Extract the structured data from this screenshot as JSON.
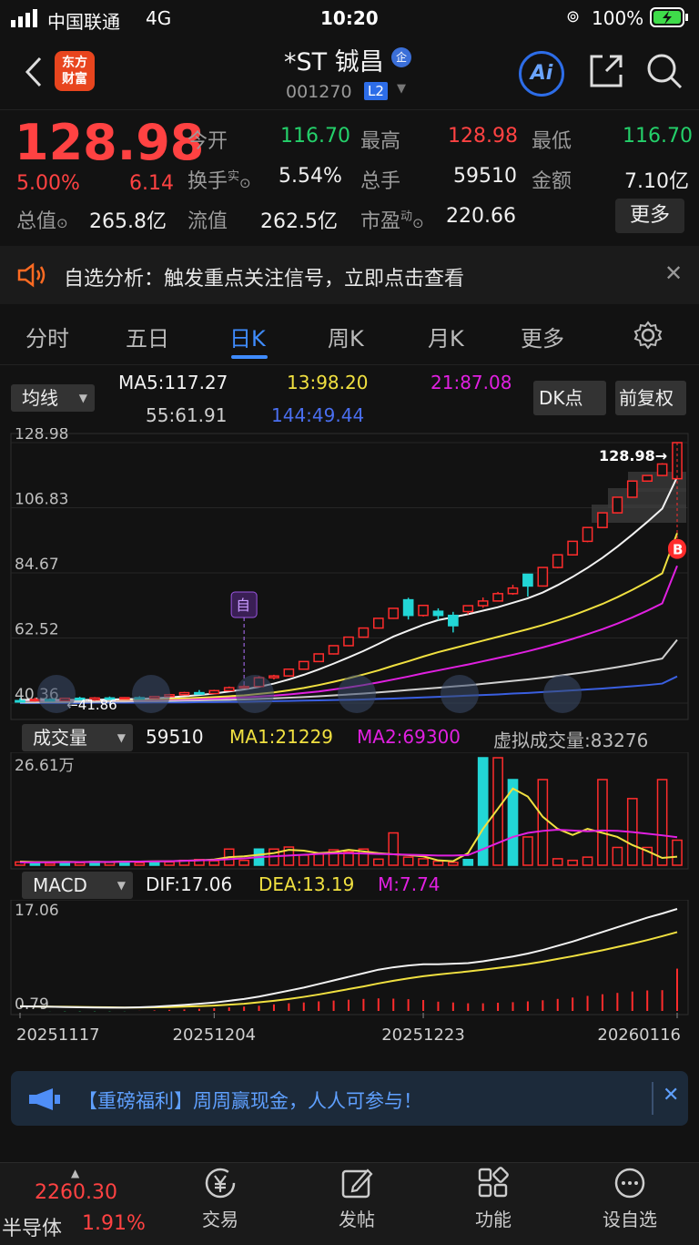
{
  "status": {
    "carrier": "中国联通",
    "network": "4G",
    "time": "10:20",
    "battery": "100%"
  },
  "header": {
    "logo_line1": "东方",
    "logo_line2": "财富",
    "title": "*ST 铖昌",
    "code": "001270",
    "level": "L2",
    "ai_label": "Ai"
  },
  "quote": {
    "price": "128.98",
    "change_pct": "5.00%",
    "change_amt": "6.14",
    "open_label": "今开",
    "open": "116.70",
    "high_label": "最高",
    "high": "128.98",
    "low_label": "最低",
    "low": "116.70",
    "turnover_label": "换手",
    "turnover_sup": "实",
    "turnover": "5.54%",
    "volume_label": "总手",
    "volume": "59510",
    "amount_label": "金额",
    "amount": "7.10亿",
    "mktcap_label": "总值",
    "mktcap": "265.8亿",
    "float_label": "流值",
    "float_cap": "262.5亿",
    "pe_label": "市盈",
    "pe_sup": "动",
    "pe": "220.66",
    "more_label": "更多"
  },
  "notice": {
    "text": "自选分析：触发重点关注信号，立即点击查看"
  },
  "tabs": [
    {
      "label": "分时"
    },
    {
      "label": "五日"
    },
    {
      "label": "日K"
    },
    {
      "label": "周K"
    },
    {
      "label": "月K"
    },
    {
      "label": "更多"
    }
  ],
  "active_tab": "日K",
  "kline_header": {
    "indicator": "均线",
    "ma5": "MA5:117.27",
    "ma13": "13:98.20",
    "ma21": "21:87.08",
    "ma55": "55:61.91",
    "ma144": "144:49.44",
    "dk_label": "DK点",
    "adjust_label": "前复权",
    "badge_self": "自",
    "badge_buy": "B",
    "latest_tag": "128.98"
  },
  "volume_header": {
    "indicator": "成交量",
    "vol": "59510",
    "ma1": "MA1:21229",
    "ma2": "MA2:69300",
    "virtual": "虚拟成交量:83276"
  },
  "macd_header": {
    "indicator": "MACD",
    "dif": "DIF:17.06",
    "dea": "DEA:13.19",
    "m": "M:7.74"
  },
  "colors": {
    "up": "#ff2c2c",
    "down": "#22d6d6",
    "ma5": "#f2f2f2",
    "ma13": "#f0e040",
    "ma21": "#e020e0",
    "ma55": "#cfcfcf",
    "ma144": "#3a5fe0"
  },
  "chart_data": [
    {
      "type": "candlestick",
      "title": "日K",
      "y_ticks": [
        "128.98",
        "106.83",
        "84.67",
        "62.52",
        "40.36"
      ],
      "ylim": [
        40.36,
        128.98
      ],
      "min_label": "41.86",
      "candles": [
        {
          "o": 41.2,
          "h": 42.0,
          "l": 40.6,
          "c": 41.0
        },
        {
          "o": 41.4,
          "h": 42.2,
          "l": 40.8,
          "c": 41.6
        },
        {
          "o": 41.6,
          "h": 42.0,
          "l": 40.9,
          "c": 41.1
        },
        {
          "o": 41.2,
          "h": 42.2,
          "l": 41.0,
          "c": 42.0
        },
        {
          "o": 42.0,
          "h": 42.5,
          "l": 41.3,
          "c": 41.5
        },
        {
          "o": 41.5,
          "h": 42.4,
          "l": 41.2,
          "c": 42.1
        },
        {
          "o": 42.1,
          "h": 42.6,
          "l": 41.6,
          "c": 41.9
        },
        {
          "o": 41.9,
          "h": 42.4,
          "l": 41.7,
          "c": 42.2
        },
        {
          "o": 42.2,
          "h": 42.7,
          "l": 41.9,
          "c": 42.0
        },
        {
          "o": 42.0,
          "h": 42.8,
          "l": 41.86,
          "c": 42.6
        },
        {
          "o": 42.6,
          "h": 43.5,
          "l": 42.4,
          "c": 43.2
        },
        {
          "o": 43.2,
          "h": 44.2,
          "l": 43.0,
          "c": 43.9
        },
        {
          "o": 43.9,
          "h": 44.8,
          "l": 43.4,
          "c": 43.6
        },
        {
          "o": 43.6,
          "h": 44.9,
          "l": 43.5,
          "c": 44.6
        },
        {
          "o": 44.6,
          "h": 46.0,
          "l": 44.4,
          "c": 45.6
        },
        {
          "o": 45.6,
          "h": 46.6,
          "l": 45.3,
          "c": 46.0
        },
        {
          "o": 46.0,
          "h": 49.5,
          "l": 45.8,
          "c": 49.0
        },
        {
          "o": 49.0,
          "h": 50.0,
          "l": 48.4,
          "c": 49.6
        },
        {
          "o": 49.6,
          "h": 52.0,
          "l": 49.4,
          "c": 51.9
        },
        {
          "o": 51.9,
          "h": 54.6,
          "l": 51.7,
          "c": 54.5
        },
        {
          "o": 54.5,
          "h": 57.2,
          "l": 54.3,
          "c": 57.1
        },
        {
          "o": 57.1,
          "h": 60.0,
          "l": 56.9,
          "c": 59.9
        },
        {
          "o": 59.9,
          "h": 62.9,
          "l": 59.7,
          "c": 62.8
        },
        {
          "o": 62.8,
          "h": 65.9,
          "l": 62.6,
          "c": 65.9
        },
        {
          "o": 65.9,
          "h": 69.2,
          "l": 65.7,
          "c": 69.2
        },
        {
          "o": 69.2,
          "h": 72.6,
          "l": 69.0,
          "c": 72.6
        },
        {
          "o": 75.5,
          "h": 76.2,
          "l": 68.8,
          "c": 70.2
        },
        {
          "o": 70.2,
          "h": 73.8,
          "l": 69.8,
          "c": 73.6
        },
        {
          "o": 71.6,
          "h": 72.6,
          "l": 68.6,
          "c": 70.2
        },
        {
          "o": 70.2,
          "h": 71.4,
          "l": 64.4,
          "c": 66.7
        },
        {
          "o": 71.5,
          "h": 73.5,
          "l": 70.6,
          "c": 73.5
        },
        {
          "o": 73.5,
          "h": 76.3,
          "l": 72.8,
          "c": 75.1
        },
        {
          "o": 75.1,
          "h": 78.2,
          "l": 74.9,
          "c": 77.6
        },
        {
          "o": 77.6,
          "h": 80.6,
          "l": 77.2,
          "c": 79.5
        },
        {
          "o": 84.2,
          "h": 84.3,
          "l": 76.6,
          "c": 80.2
        },
        {
          "o": 80.2,
          "h": 86.6,
          "l": 80.0,
          "c": 86.5
        },
        {
          "o": 86.5,
          "h": 90.8,
          "l": 86.2,
          "c": 90.8
        },
        {
          "o": 90.8,
          "h": 95.4,
          "l": 90.6,
          "c": 95.4
        },
        {
          "o": 95.4,
          "h": 100.1,
          "l": 95.1,
          "c": 100.1
        },
        {
          "o": 100.1,
          "h": 105.1,
          "l": 99.9,
          "c": 105.1
        },
        {
          "o": 105.1,
          "h": 110.4,
          "l": 104.9,
          "c": 110.4
        },
        {
          "o": 110.4,
          "h": 115.9,
          "l": 110.2,
          "c": 115.9
        },
        {
          "o": 115.9,
          "h": 117.9,
          "l": 115.7,
          "c": 117.8
        },
        {
          "o": 117.8,
          "h": 122.0,
          "l": 117.6,
          "c": 121.7
        },
        {
          "o": 116.7,
          "h": 128.98,
          "l": 116.7,
          "c": 128.98
        }
      ],
      "ma_lines": {
        "ma5": [
          41.5,
          41.5,
          41.4,
          41.5,
          41.4,
          41.5,
          41.6,
          41.7,
          41.8,
          42.0,
          42.3,
          42.7,
          43.1,
          43.6,
          44.3,
          45.0,
          45.9,
          47.0,
          48.4,
          50.0,
          51.8,
          53.8,
          55.9,
          58.1,
          60.5,
          63.0,
          65.0,
          67.0,
          68.6,
          69.6,
          70.6,
          71.8,
          73.0,
          74.5,
          76.0,
          78.0,
          80.5,
          83.3,
          86.4,
          89.8,
          93.6,
          97.7,
          102.0,
          106.5,
          117.27
        ],
        "ma13": [
          41.4,
          41.4,
          41.4,
          41.4,
          41.4,
          41.4,
          41.5,
          41.5,
          41.6,
          41.7,
          41.8,
          42.0,
          42.2,
          42.4,
          42.7,
          43.0,
          43.5,
          44.0,
          44.7,
          45.5,
          46.5,
          47.6,
          48.8,
          50.1,
          51.5,
          53.1,
          54.6,
          56.2,
          57.7,
          59.0,
          60.3,
          61.6,
          62.9,
          64.2,
          65.5,
          66.9,
          68.5,
          70.2,
          72.1,
          74.1,
          76.4,
          78.9,
          81.6,
          84.5,
          98.2
        ],
        "ma21": [
          41.3,
          41.3,
          41.3,
          41.3,
          41.4,
          41.4,
          41.4,
          41.4,
          41.5,
          41.5,
          41.6,
          41.7,
          41.8,
          41.9,
          42.1,
          42.3,
          42.6,
          42.9,
          43.3,
          43.8,
          44.3,
          45.0,
          45.7,
          46.5,
          47.4,
          48.4,
          49.4,
          50.5,
          51.5,
          52.5,
          53.5,
          54.6,
          55.7,
          56.8,
          58.0,
          59.3,
          60.7,
          62.2,
          63.8,
          65.5,
          67.4,
          69.5,
          71.8,
          74.3,
          87.08
        ],
        "ma55": [
          40.6,
          40.6,
          40.7,
          40.7,
          40.8,
          40.8,
          40.9,
          40.9,
          41.0,
          41.0,
          41.1,
          41.2,
          41.3,
          41.4,
          41.5,
          41.6,
          41.8,
          42.0,
          42.2,
          42.4,
          42.7,
          43.0,
          43.3,
          43.6,
          44.0,
          44.4,
          44.8,
          45.2,
          45.6,
          46.0,
          46.4,
          46.9,
          47.4,
          47.9,
          48.4,
          49.0,
          49.6,
          50.3,
          51.0,
          51.8,
          52.6,
          53.5,
          54.5,
          55.5,
          61.91
        ],
        "ma144": [
          40.4,
          40.4,
          40.4,
          40.4,
          40.4,
          40.5,
          40.5,
          40.5,
          40.5,
          40.6,
          40.6,
          40.6,
          40.7,
          40.7,
          40.8,
          40.8,
          40.9,
          41.0,
          41.1,
          41.2,
          41.3,
          41.4,
          41.5,
          41.6,
          41.8,
          41.9,
          42.1,
          42.3,
          42.5,
          42.7,
          42.9,
          43.1,
          43.3,
          43.6,
          43.8,
          44.1,
          44.4,
          44.7,
          45.0,
          45.3,
          45.7,
          46.1,
          46.5,
          47.0,
          49.44
        ]
      }
    },
    {
      "type": "bar",
      "title": "成交量",
      "y_ticks": [
        "26.61万"
      ],
      "ylim": [
        0,
        266100
      ],
      "values": [
        8000,
        6000,
        5000,
        7000,
        6000,
        9000,
        7000,
        9000,
        6000,
        9000,
        8000,
        12000,
        14000,
        11000,
        40000,
        12000,
        40000,
        40000,
        45000,
        25000,
        30000,
        38000,
        33000,
        40000,
        15000,
        80000,
        20000,
        16000,
        10000,
        7000,
        14000,
        266100,
        266100,
        212000,
        70000,
        212000,
        16000,
        12000,
        20000,
        212000,
        44000,
        165000,
        44000,
        212000,
        62000
      ],
      "down_days": [
        1,
        3,
        5,
        7,
        9,
        16,
        30,
        31,
        33
      ],
      "ma1": [
        9000,
        8000,
        8000,
        8500,
        8000,
        8500,
        8000,
        9000,
        9000,
        9500,
        10000,
        11000,
        12000,
        14000,
        20000,
        22000,
        26000,
        30000,
        38000,
        36000,
        30000,
        32000,
        38000,
        34000,
        30000,
        27000,
        25000,
        22000,
        12000,
        10000,
        30000,
        90000,
        140000,
        190000,
        170000,
        120000,
        90000,
        75000,
        90000,
        80000,
        70000,
        50000,
        35000,
        18000,
        21229
      ],
      "ma2": [
        7000,
        7000,
        7200,
        7500,
        7800,
        8000,
        8200,
        8500,
        9000,
        9500,
        10000,
        11000,
        12000,
        13000,
        15000,
        17000,
        20000,
        22000,
        24000,
        26000,
        28000,
        29000,
        30000,
        29000,
        28000,
        27000,
        26000,
        25000,
        24000,
        24000,
        25000,
        40000,
        55000,
        70000,
        80000,
        85000,
        88000,
        86000,
        84000,
        86000,
        85000,
        82000,
        78000,
        74000,
        69300
      ]
    },
    {
      "type": "line",
      "title": "MACD",
      "y_ticks": [
        "17.06",
        "0.79"
      ],
      "x_ticks": [
        "20251117",
        "20251204",
        "20251223",
        "20260116"
      ],
      "dif": [
        0.79,
        0.75,
        0.7,
        0.65,
        0.6,
        0.58,
        0.55,
        0.55,
        0.6,
        0.7,
        0.85,
        1.0,
        1.2,
        1.4,
        1.7,
        2.0,
        2.4,
        2.9,
        3.4,
        3.9,
        4.5,
        5.1,
        5.7,
        6.3,
        6.9,
        7.3,
        7.6,
        7.8,
        7.8,
        7.9,
        8.0,
        8.3,
        8.7,
        9.1,
        9.6,
        10.2,
        10.9,
        11.6,
        12.4,
        13.2,
        14.0,
        14.8,
        15.6,
        16.3,
        17.06
      ],
      "dea": [
        0.79,
        0.75,
        0.72,
        0.7,
        0.66,
        0.63,
        0.6,
        0.58,
        0.58,
        0.6,
        0.65,
        0.72,
        0.8,
        0.9,
        1.05,
        1.2,
        1.45,
        1.7,
        2.0,
        2.35,
        2.75,
        3.2,
        3.65,
        4.1,
        4.6,
        5.05,
        5.45,
        5.8,
        6.1,
        6.35,
        6.6,
        6.9,
        7.2,
        7.5,
        7.85,
        8.25,
        8.7,
        9.15,
        9.65,
        10.15,
        10.7,
        11.25,
        11.85,
        12.5,
        13.19
      ],
      "m": [
        0.0,
        0.0,
        -0.02,
        -0.05,
        -0.06,
        -0.05,
        -0.05,
        -0.03,
        0.02,
        0.1,
        0.2,
        0.28,
        0.4,
        0.5,
        0.65,
        0.8,
        0.95,
        1.2,
        1.4,
        1.55,
        1.75,
        1.9,
        2.05,
        2.2,
        2.3,
        2.25,
        2.15,
        2.0,
        1.7,
        1.55,
        1.4,
        1.4,
        1.5,
        1.6,
        1.75,
        1.95,
        2.2,
        2.45,
        2.75,
        3.05,
        3.3,
        3.55,
        3.75,
        3.8,
        7.74
      ]
    }
  ],
  "banner": {
    "text": "【重磅福利】周周赢现金，人人可参与！"
  },
  "bottom": {
    "index_value": "2260.30",
    "index_name": "半导体",
    "index_pct": "1.91%",
    "items": [
      {
        "label": "交易"
      },
      {
        "label": "发帖"
      },
      {
        "label": "功能"
      },
      {
        "label": "设自选"
      }
    ]
  }
}
